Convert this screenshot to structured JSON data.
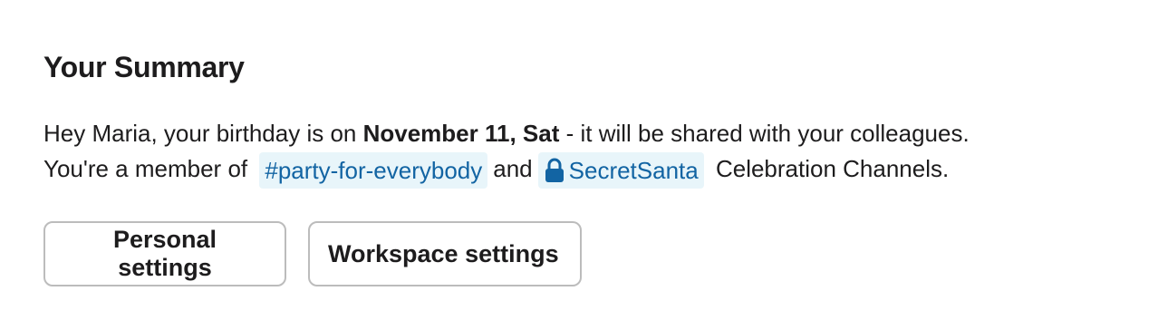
{
  "summary": {
    "title": "Your Summary",
    "line1_prefix": "Hey Maria, your birthday is on ",
    "birthday": "November 11, Sat",
    "line1_suffix": " - it will be shared with your colleagues.",
    "line2_prefix": "You're a member of ",
    "channel_public": "#party-for-everybody",
    "conjunction": "and",
    "channel_private": "SecretSanta",
    "line2_suffix": " Celebration Channels."
  },
  "buttons": {
    "personal_label": "Personal settings",
    "workspace_label": "Workspace settings"
  },
  "icons": {
    "private_channel": "lock-icon"
  },
  "colors": {
    "text": "#1d1c1d",
    "link": "#1264a3",
    "chip_bg": "#e8f5fa",
    "button_border": "#bcbcbc"
  }
}
